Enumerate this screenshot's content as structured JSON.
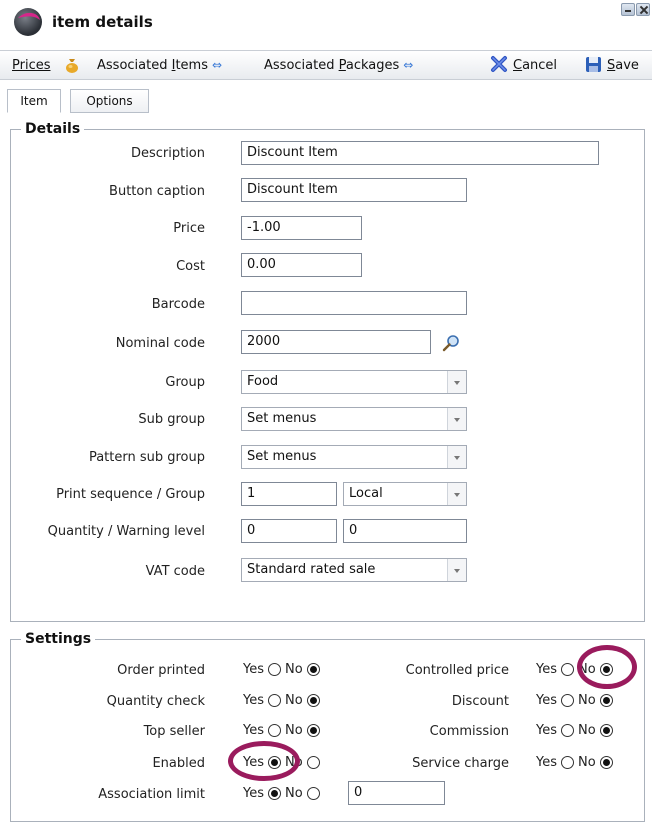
{
  "window": {
    "title": "item details"
  },
  "toolbar": {
    "prices": "Prices",
    "assoc_items_pre": "Associated ",
    "assoc_items_u": "I",
    "assoc_items_post": "tems",
    "assoc_pkgs_pre": "Associated ",
    "assoc_pkgs_u": "P",
    "assoc_pkgs_post": "ackages",
    "cancel_u": "C",
    "cancel_post": "ancel",
    "save_u": "S",
    "save_post": "ave"
  },
  "tabs": [
    {
      "label": "Item",
      "active": true
    },
    {
      "label": "Options",
      "active": false
    }
  ],
  "details": {
    "legend": "Details",
    "description": {
      "label": "Description",
      "value": "Discount Item"
    },
    "button_caption": {
      "label": "Button caption",
      "value": "Discount Item"
    },
    "price": {
      "label": "Price",
      "value": "-1.00"
    },
    "cost": {
      "label": "Cost",
      "value": "0.00"
    },
    "barcode": {
      "label": "Barcode",
      "value": ""
    },
    "nominal_code": {
      "label": "Nominal code",
      "value": "2000"
    },
    "group": {
      "label": "Group",
      "value": "Food"
    },
    "sub_group": {
      "label": "Sub group",
      "value": "Set menus"
    },
    "pattern_sub_group": {
      "label": "Pattern sub group",
      "value": "Set menus"
    },
    "print_sequence": {
      "label": "Print sequence / Group",
      "value": "1",
      "group_value": "Local"
    },
    "quantity": {
      "label": "Quantity / Warning level",
      "value": "0",
      "warning_value": "0"
    },
    "vat_code": {
      "label": "VAT code",
      "value": "Standard rated sale"
    }
  },
  "settings": {
    "legend": "Settings",
    "yes": "Yes",
    "no": "No",
    "order_printed": {
      "label": "Order printed",
      "selected": "No"
    },
    "quantity_check": {
      "label": "Quantity check",
      "selected": "No"
    },
    "top_seller": {
      "label": "Top seller",
      "selected": "No"
    },
    "enabled": {
      "label": "Enabled",
      "selected": "Yes"
    },
    "association_limit": {
      "label": "Association limit",
      "selected": "Yes",
      "value": "0"
    },
    "controlled_price": {
      "label": "Controlled price",
      "selected": "No"
    },
    "discount": {
      "label": "Discount",
      "selected": "No"
    },
    "commission": {
      "label": "Commission",
      "selected": "No"
    },
    "service_charge": {
      "label": "Service charge",
      "selected": "No"
    }
  },
  "colors": {
    "highlight": "#9a1b5d",
    "accent": "#3b7ad6"
  }
}
